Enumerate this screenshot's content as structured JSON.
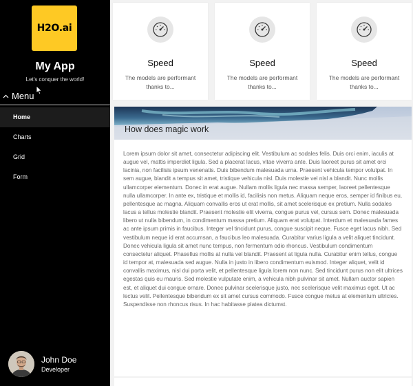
{
  "sidebar": {
    "logo_text": "H2O.ai",
    "app_title": "My App",
    "app_subtitle": "Let's conquer the world!",
    "menu_label": "Menu",
    "nav_items": [
      {
        "label": "Home",
        "active": true
      },
      {
        "label": "Charts",
        "active": false
      },
      {
        "label": "Grid",
        "active": false
      },
      {
        "label": "Form",
        "active": false
      }
    ],
    "user": {
      "name": "John Doe",
      "role": "Developer"
    }
  },
  "cards": [
    {
      "icon": "speedometer-icon",
      "title": "Speed",
      "text": "The models are performant thanks to..."
    },
    {
      "icon": "speedometer-icon",
      "title": "Speed",
      "text": "The models are performant thanks to..."
    },
    {
      "icon": "speedometer-icon",
      "title": "Speed",
      "text": "The models are performant thanks to..."
    }
  ],
  "article": {
    "heading": "How does magic work",
    "body": "Lorem ipsum dolor sit amet, consectetur adipiscing elit. Vestibulum ac sodales felis. Duis orci enim, iaculis at augue vel, mattis imperdiet ligula. Sed a placerat lacus, vitae viverra ante. Duis laoreet purus sit amet orci lacinia, non facilisis ipsum venenatis. Duis bibendum malesuada urna. Praesent vehicula tempor volutpat. In sem augue, blandit a tempus sit amet, tristique vehicula nisl. Duis molestie vel nisl a blandit. Nunc mollis ullamcorper elementum. Donec in erat augue. Nullam mollis ligula nec massa semper, laoreet pellentesque nulla ullamcorper. In ante ex, tristique et mollis id, facilisis non metus. Aliquam neque eros, semper id finibus eu, pellentesque ac magna. Aliquam convallis eros ut erat mollis, sit amet scelerisque ex pretium. Nulla sodales lacus a tellus molestie blandit. Praesent molestie elit viverra, congue purus vel, cursus sem. Donec malesuada libero ut nulla bibendum, in condimentum massa pretium. Aliquam erat volutpat. Interdum et malesuada fames ac ante ipsum primis in faucibus. Integer vel tincidunt purus, congue suscipit neque. Fusce eget lacus nibh. Sed vestibulum neque id erat accumsan, a faucibus leo malesuada. Curabitur varius ligula a velit aliquet tincidunt. Donec vehicula ligula sit amet nunc tempus, non fermentum odio rhoncus. Vestibulum condimentum consectetur aliquet. Phasellus mollis at nulla vel blandit. Praesent at ligula nulla. Curabitur enim tellus, congue id tempor at, malesuada sed augue. Nulla in justo in libero condimentum euismod. Integer aliquet, velit id convallis maximus, nisl dui porta velit, et pellentesque ligula lorem non nunc. Sed tincidunt purus non elit ultrices egestas quis eu mauris. Sed molestie vulputate enim, a vehicula nibh pulvinar sit amet. Nullam auctor sapien est, et aliquet dui congue ornare. Donec pulvinar scelerisque justo, nec scelerisque velit maximus eget. Ut ac lectus velit. Pellentesque bibendum ex sit amet cursus commodo. Fusce congue metus at elementum ultricies. Suspendisse non rhoncus risus. In hac habitasse platea dictumst."
  },
  "colors": {
    "sidebar_bg": "#000000",
    "logo_bg": "#fec924",
    "page_bg": "#f2f2f2",
    "active_nav_bg": "#1c1c1c"
  }
}
